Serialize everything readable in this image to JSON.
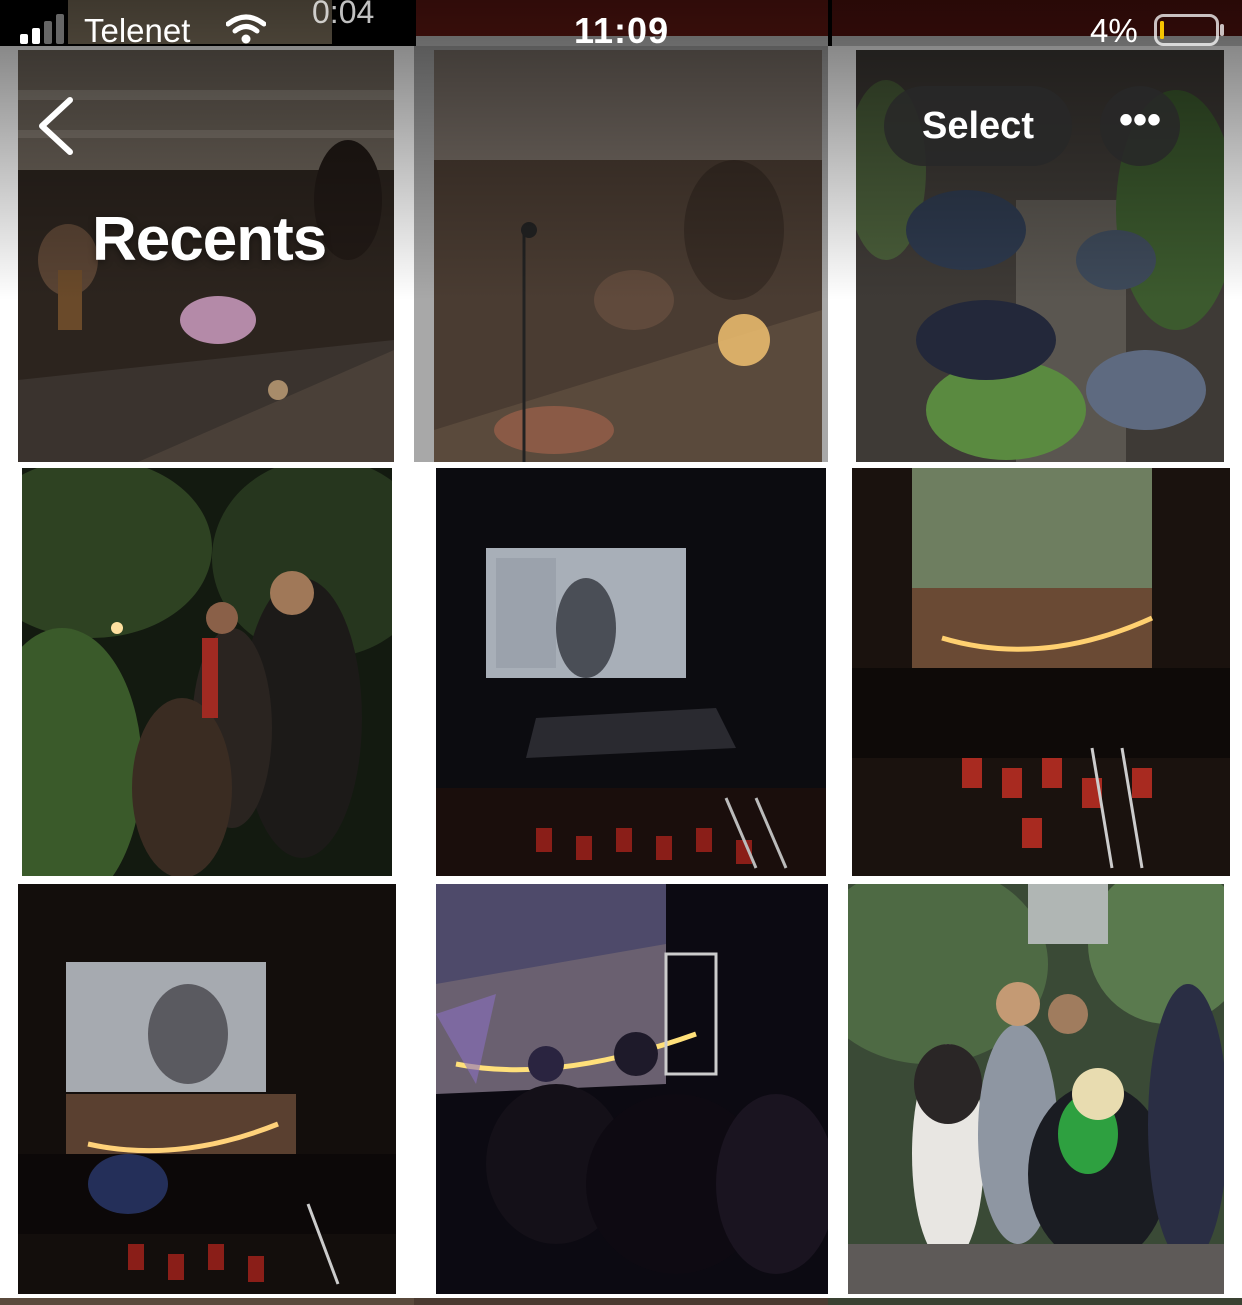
{
  "status_bar": {
    "carrier": "Telenet",
    "time": "11:09",
    "battery_percent": "4%",
    "video_duration_peek": "0:04",
    "icons": [
      "cellular-signal-icon",
      "wifi-icon",
      "battery-icon"
    ]
  },
  "header": {
    "title": "Recents",
    "back_icon": "chevron-left-icon",
    "select_label": "Select",
    "more_label": "•••"
  },
  "photos": [
    {
      "label": "photo-bar-crowd",
      "palette": [
        "#3a2f27",
        "#6b5a4a",
        "#1c1613"
      ]
    },
    {
      "label": "photo-double-exposure",
      "palette": [
        "#4a3a2e",
        "#8a6a4e",
        "#1e1814"
      ]
    },
    {
      "label": "photo-garden-overhead",
      "palette": [
        "#3c4a34",
        "#6e7e5a",
        "#1e261a"
      ]
    },
    {
      "label": "photo-garden-night",
      "palette": [
        "#1c2418",
        "#3e4e2e",
        "#0e120c"
      ]
    },
    {
      "label": "photo-cinema-screen",
      "palette": [
        "#0e0e14",
        "#9aa2ae",
        "#2a1a16"
      ]
    },
    {
      "label": "photo-hall-lights",
      "palette": [
        "#241a14",
        "#6e7a5e",
        "#120c0a"
      ]
    },
    {
      "label": "photo-hall-screen-crowd",
      "palette": [
        "#1a1412",
        "#8c9098",
        "#0c0a08"
      ]
    },
    {
      "label": "photo-stage-purple",
      "palette": [
        "#1a1426",
        "#5e4a8a",
        "#0a0810"
      ]
    },
    {
      "label": "photo-dog-garden",
      "palette": [
        "#4e5e4a",
        "#9aa0a6",
        "#2a3228"
      ]
    }
  ]
}
